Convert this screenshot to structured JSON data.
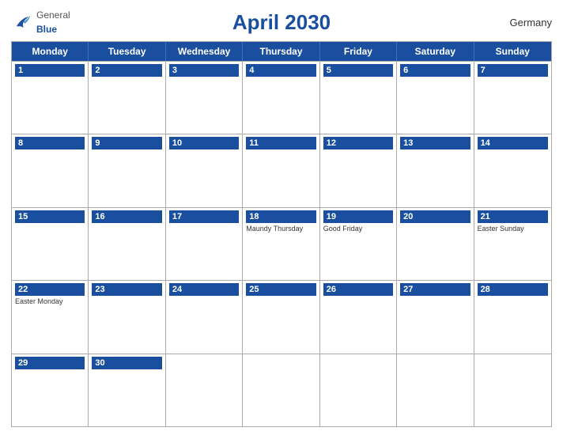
{
  "header": {
    "title": "April 2030",
    "country": "Germany",
    "logo": {
      "general": "General",
      "blue": "Blue"
    }
  },
  "days": [
    "Monday",
    "Tuesday",
    "Wednesday",
    "Thursday",
    "Friday",
    "Saturday",
    "Sunday"
  ],
  "weeks": [
    [
      {
        "date": "1",
        "holiday": ""
      },
      {
        "date": "2",
        "holiday": ""
      },
      {
        "date": "3",
        "holiday": ""
      },
      {
        "date": "4",
        "holiday": ""
      },
      {
        "date": "5",
        "holiday": ""
      },
      {
        "date": "6",
        "holiday": ""
      },
      {
        "date": "7",
        "holiday": ""
      }
    ],
    [
      {
        "date": "8",
        "holiday": ""
      },
      {
        "date": "9",
        "holiday": ""
      },
      {
        "date": "10",
        "holiday": ""
      },
      {
        "date": "11",
        "holiday": ""
      },
      {
        "date": "12",
        "holiday": ""
      },
      {
        "date": "13",
        "holiday": ""
      },
      {
        "date": "14",
        "holiday": ""
      }
    ],
    [
      {
        "date": "15",
        "holiday": ""
      },
      {
        "date": "16",
        "holiday": ""
      },
      {
        "date": "17",
        "holiday": ""
      },
      {
        "date": "18",
        "holiday": "Maundy Thursday"
      },
      {
        "date": "19",
        "holiday": "Good Friday"
      },
      {
        "date": "20",
        "holiday": ""
      },
      {
        "date": "21",
        "holiday": "Easter Sunday"
      }
    ],
    [
      {
        "date": "22",
        "holiday": "Easter Monday"
      },
      {
        "date": "23",
        "holiday": ""
      },
      {
        "date": "24",
        "holiday": ""
      },
      {
        "date": "25",
        "holiday": ""
      },
      {
        "date": "26",
        "holiday": ""
      },
      {
        "date": "27",
        "holiday": ""
      },
      {
        "date": "28",
        "holiday": ""
      }
    ],
    [
      {
        "date": "29",
        "holiday": ""
      },
      {
        "date": "30",
        "holiday": ""
      },
      {
        "date": "",
        "holiday": ""
      },
      {
        "date": "",
        "holiday": ""
      },
      {
        "date": "",
        "holiday": ""
      },
      {
        "date": "",
        "holiday": ""
      },
      {
        "date": "",
        "holiday": ""
      }
    ]
  ]
}
